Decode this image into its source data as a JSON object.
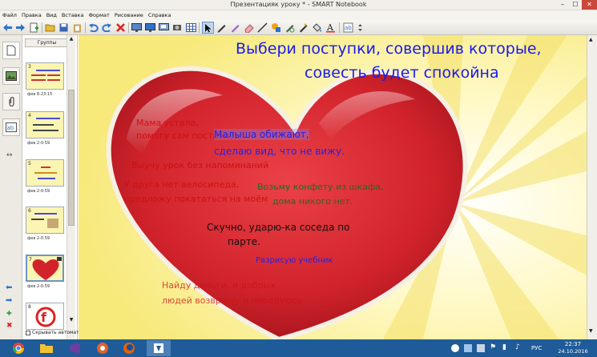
{
  "window": {
    "title": "Презентацияк уроку * - SMART Notebook",
    "minimize": "–",
    "maximize": "☐",
    "close": "✕"
  },
  "menu": [
    "Файл",
    "Правка",
    "Вид",
    "Вставка",
    "Формат",
    "Рисование",
    "Справка"
  ],
  "sorter": {
    "groups_label": "Группы",
    "thumbnails": [
      {
        "num": "3",
        "caption": "фев 8-23:15"
      },
      {
        "num": "4",
        "caption": "фев 2-0:59"
      },
      {
        "num": "5",
        "caption": "фев 2-0:59"
      },
      {
        "num": "6",
        "caption": "фев 2-0:59"
      },
      {
        "num": "7",
        "caption": "фев 2-0:59"
      },
      {
        "num": "8",
        "caption": ""
      }
    ],
    "hide_auto": "Скрывать автомат"
  },
  "slide": {
    "title_line1": "Выбери поступки, совершив которые,",
    "title_line2": "совесть будет спокойна",
    "statements": {
      "mom_tired_1": "Мама устала,",
      "mom_tired_2": "помогу сам поставить",
      "kid_offended_1": "Малыша обижают,",
      "kid_offended_2": "сделаю вид, что не вижу.",
      "homework": "Выучу урок без напоминаний",
      "bike_1": "У друга нет велосипеда,",
      "bike_2": "предложу покататься на моём",
      "candy_1": "Возьму конфету из шкафа,",
      "candy_2": "дома никого нет.",
      "bored_1": "Скучно, ударю-ка соседа по",
      "bored_2": "парте.",
      "textbook": "Разрисую учебник",
      "bottom_1": "Найду деньги, и добрых",
      "bottom_2": "людей возвращу и порадуюсь"
    },
    "colors": {
      "background": "#fff8b5",
      "heart": "#d2232c",
      "title": "#1a1aee",
      "red_text": "#cc1111",
      "blue_text": "#2222ee",
      "green_text": "#226b1f",
      "black_text": "#111111"
    }
  },
  "taskbar": {
    "lang": "РУС",
    "time": "22:37",
    "date": "24.10.2016"
  }
}
